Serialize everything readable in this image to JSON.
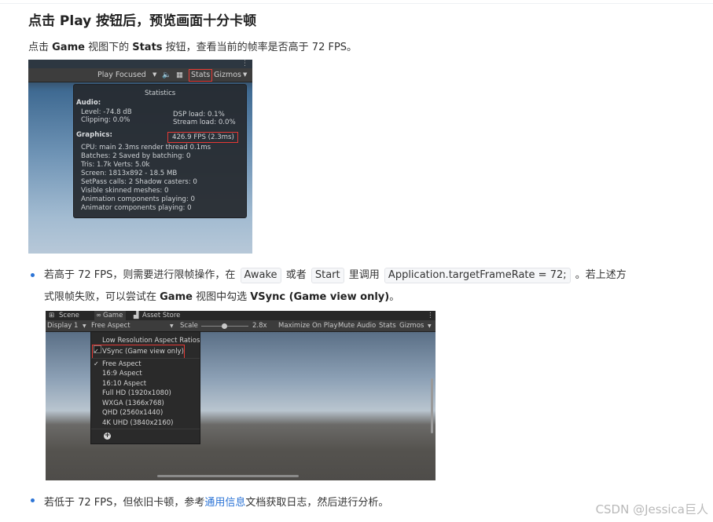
{
  "heading": "点击 Play 按钮后，预览画面十分卡顿",
  "intro": {
    "pre": "点击 ",
    "game": "Game",
    "mid": " 视图下的 ",
    "stats": "Stats",
    "post": " 按钮，查看当前的帧率是否高于 72 FPS。"
  },
  "shot1": {
    "toolbar": {
      "play_focused": "Play Focused",
      "stats": "Stats",
      "gizmos": "Gizmos"
    },
    "panel": {
      "title": "Statistics",
      "audio_header": "Audio:",
      "level": "Level: -74.8 dB",
      "clipping": "Clipping: 0.0%",
      "dsp_load": "DSP load: 0.1%",
      "stream_load": "Stream load: 0.0%",
      "graphics_header": "Graphics:",
      "fps": "426.9 FPS (2.3ms)",
      "cpu": "CPU: main 2.3ms  render thread 0.1ms",
      "batches": "Batches: 2     Saved by batching: 0",
      "tris": "Tris: 1.7k       Verts: 5.0k",
      "screen": "Screen: 1813x892 - 18.5 MB",
      "setpass": "SetPass calls: 2        Shadow casters: 0",
      "skinned": "Visible skinned meshes: 0",
      "animation": "Animation components playing: 0",
      "animator": "Animator components playing: 0"
    }
  },
  "bullet1": {
    "pre": "若高于 72 FPS，则需要进行限帧操作，在",
    "awake": "Awake",
    "or": "或者",
    "start": "Start",
    "call": "里调用",
    "code": "Application.targetFrameRate = 72;",
    "post": "。若上述方",
    "line2_pre": "式限帧失败，可以尝试在 ",
    "game": "Game",
    "line2_mid": " 视图中勾选 ",
    "vsync": "VSync (Game view only)",
    "line2_post": "。"
  },
  "shot2": {
    "tabs": {
      "scene": "Scene",
      "game": "Game",
      "asset_store": "Asset Store"
    },
    "toolbar": {
      "display": "Display 1",
      "aspect": "Free Aspect",
      "scale_label": "Scale",
      "scale_value": "2.8x",
      "maximize": "Maximize On Play",
      "mute": "Mute Audio",
      "stats": "Stats",
      "gizmos": "Gizmos"
    },
    "menu": {
      "low_res": "Low Resolution Aspect Ratios",
      "vsync": "VSync (Game view only)",
      "options": [
        "Free Aspect",
        "16:9 Aspect",
        "16:10 Aspect",
        "Full HD (1920x1080)",
        "WXGA (1366x768)",
        "QHD (2560x1440)",
        "4K UHD (3840x2160)"
      ]
    }
  },
  "bullet2": {
    "pre": "若低于 72 FPS，但依旧卡顿，参考",
    "link": "通用信息",
    "post": "文档获取日志，然后进行分析。"
  },
  "watermark": "CSDN @Jessica巨人",
  "colors": {
    "link": "#2c74d6",
    "highlight_box": "#e53935"
  }
}
